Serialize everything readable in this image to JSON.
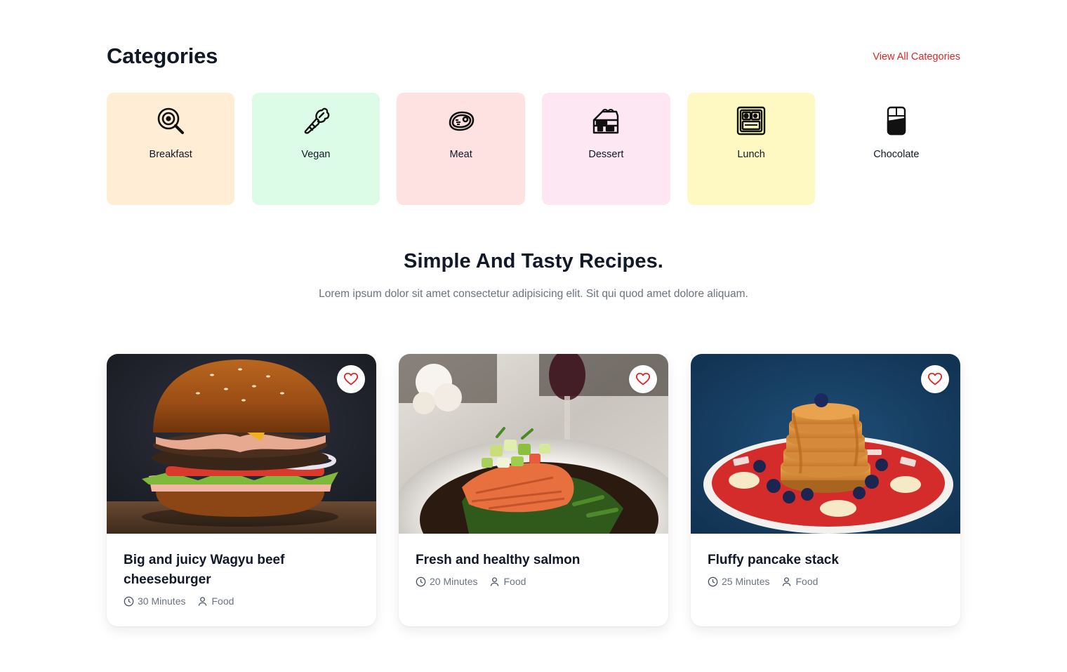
{
  "categories_section": {
    "title": "Categories",
    "view_all": "View All Categories",
    "items": [
      {
        "label": "Breakfast",
        "icon": "frying-pan-icon",
        "bg": "#ffedd5"
      },
      {
        "label": "Vegan",
        "icon": "vegetable-icon",
        "bg": "#dcfce7"
      },
      {
        "label": "Meat",
        "icon": "meat-steak-icon",
        "bg": "#fee2e2"
      },
      {
        "label": "Dessert",
        "icon": "cake-slice-icon",
        "bg": "#fce7f3"
      },
      {
        "label": "Lunch",
        "icon": "lunch-box-icon",
        "bg": "#fef9c3"
      },
      {
        "label": "Chocolate",
        "icon": "chocolate-bar-icon",
        "bg": "#ffffff"
      }
    ]
  },
  "recipes_section": {
    "title": "Simple And Tasty Recipes.",
    "description": "Lorem ipsum dolor sit amet consectetur adipisicing elit. Sit qui quod amet dolore aliquam.",
    "cards": [
      {
        "title": "Big and juicy Wagyu beef cheeseburger",
        "time": "30 Minutes",
        "category": "Food",
        "image": "burger-photo"
      },
      {
        "title": "Fresh and healthy salmon",
        "time": "20 Minutes",
        "category": "Food",
        "image": "salmon-photo"
      },
      {
        "title": "Fluffy pancake stack",
        "time": "25 Minutes",
        "category": "Food",
        "image": "pancake-photo"
      }
    ]
  },
  "colors": {
    "accent": "#dc2626",
    "heading": "#111827",
    "muted": "#6b7280"
  }
}
